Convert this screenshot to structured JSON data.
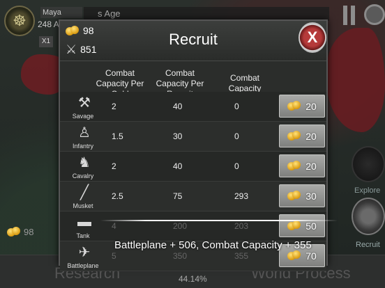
{
  "background": {
    "player_name": "Maya",
    "player_year": "248 A",
    "speed": "X1",
    "top_title_fragment": "s Age",
    "side_gold": "98",
    "explore_label": "Explore",
    "recruit_label": "Recruit",
    "research_label": "Research",
    "world_label": "World Process",
    "percent": "44.14%"
  },
  "dialog": {
    "gold": "98",
    "combat": "851",
    "title": "Recruit",
    "close_label": "X",
    "headers": {
      "per_gold": "Combat Capacity Per Gold",
      "per_recruit": "Combat Capacity Per Recruit",
      "capacity": "Combat Capacity"
    },
    "units": [
      {
        "name": "Savage",
        "per_gold": "2",
        "per_recruit": "40",
        "capacity": "0",
        "cost": "20",
        "icon": "axe-icon"
      },
      {
        "name": "Infantry",
        "per_gold": "1.5",
        "per_recruit": "30",
        "capacity": "0",
        "cost": "20",
        "icon": "infantry-icon"
      },
      {
        "name": "Cavalry",
        "per_gold": "2",
        "per_recruit": "40",
        "capacity": "0",
        "cost": "20",
        "icon": "cavalry-icon"
      },
      {
        "name": "Musket",
        "per_gold": "2.5",
        "per_recruit": "75",
        "capacity": "293",
        "cost": "30",
        "icon": "musket-icon"
      },
      {
        "name": "Tank",
        "per_gold": "4",
        "per_recruit": "200",
        "capacity": "203",
        "cost": "50",
        "icon": "tank-icon"
      },
      {
        "name": "Battleplane",
        "per_gold": "5",
        "per_recruit": "350",
        "capacity": "355",
        "cost": "70",
        "icon": "battleplane-icon"
      }
    ]
  },
  "toast": {
    "message": "Battleplane + 506, Combat Capacity + 355"
  },
  "colors": {
    "dialog_bg": "#2b2d2b",
    "button_bg": "#949593",
    "close_red": "#b53a3a",
    "gold": "#e8b020"
  }
}
